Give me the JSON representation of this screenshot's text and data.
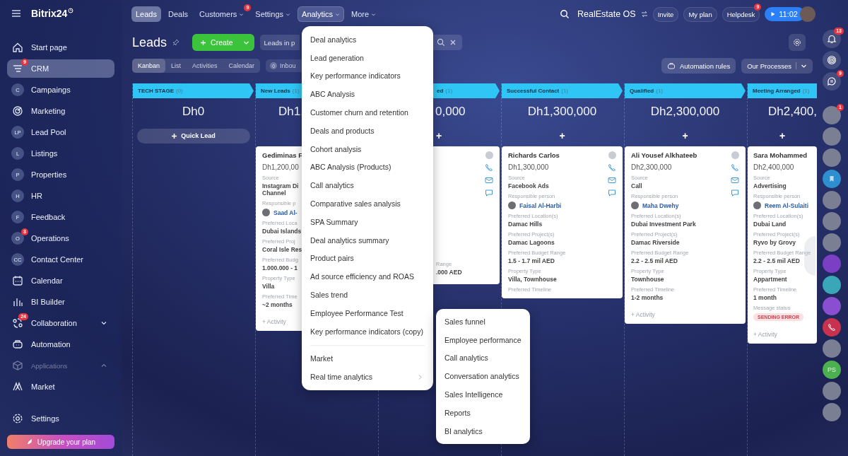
{
  "sidebar": {
    "brand": "Bitrix24",
    "items": [
      {
        "label": "Start page",
        "kind": "home",
        "selected": false
      },
      {
        "label": "CRM",
        "kind": "crm",
        "badge": "9",
        "selected": true
      },
      {
        "label": "Campaings",
        "kind": "letter",
        "letter": "C",
        "selected": false
      },
      {
        "label": "Marketing",
        "kind": "target",
        "selected": false
      },
      {
        "label": "Lead Pool",
        "kind": "letter",
        "letter": "LP",
        "selected": false
      },
      {
        "label": "Listings",
        "kind": "letter",
        "letter": "L",
        "selected": false
      },
      {
        "label": "Properties",
        "kind": "letter",
        "letter": "P",
        "selected": false
      },
      {
        "label": "HR",
        "kind": "letter",
        "letter": "H",
        "selected": false
      },
      {
        "label": "Feedback",
        "kind": "letter",
        "letter": "F",
        "selected": false
      },
      {
        "label": "Operations",
        "kind": "letter",
        "letter": "O",
        "badge": "3",
        "selected": false
      },
      {
        "label": "Contact Center",
        "kind": "letter",
        "letter": "CC",
        "selected": false
      },
      {
        "label": "Calendar",
        "kind": "calendar",
        "selected": false
      },
      {
        "label": "BI Builder",
        "kind": "chart",
        "selected": false
      },
      {
        "label": "Collaboration",
        "kind": "collab",
        "badge": "24",
        "selected": false,
        "expanded": false
      },
      {
        "label": "Automation",
        "kind": "robot",
        "selected": false
      },
      {
        "label": "Applications",
        "kind": "section",
        "selected": false,
        "expanded": true
      },
      {
        "label": "Market",
        "kind": "market",
        "selected": false
      }
    ],
    "settings": "Settings",
    "upgrade": "Upgrade your plan"
  },
  "topbar": {
    "nav": [
      {
        "label": "Leads",
        "selected": true,
        "open": false,
        "caret": false
      },
      {
        "label": "Deals",
        "selected": false,
        "open": false,
        "caret": false
      },
      {
        "label": "Customers",
        "selected": false,
        "open": false,
        "caret": true,
        "badge": "9"
      },
      {
        "label": "Settings",
        "selected": false,
        "open": false,
        "caret": true
      },
      {
        "label": "Analytics",
        "selected": false,
        "open": true,
        "caret": true
      },
      {
        "label": "More",
        "selected": false,
        "open": false,
        "caret": true
      }
    ],
    "workspace": "RealEstate OS",
    "buttons": [
      {
        "label": "Invite"
      },
      {
        "label": "My plan"
      },
      {
        "label": "Helpdesk",
        "badge": "9"
      }
    ],
    "timer": "11:02"
  },
  "header": {
    "title": "Leads",
    "create": "Create",
    "filter": "Leads in p"
  },
  "views": [
    {
      "label": "Kanban",
      "selected": true
    },
    {
      "label": "List",
      "selected": false
    },
    {
      "label": "Activities",
      "selected": false
    },
    {
      "label": "Calendar",
      "selected": false
    }
  ],
  "inbound": {
    "count": "0",
    "label": "Inbou"
  },
  "automation": "Automation rules",
  "processes": "Our Processes",
  "columns": [
    {
      "title": "TECH STAGE",
      "count": "(0)",
      "total": "Dh0",
      "add": {
        "kind": "quick",
        "label": "Quick Lead"
      }
    },
    {
      "title": "New Leads",
      "count": "(1)",
      "total": "Dh1,",
      "cards": [
        {
          "name": "Gediminas F",
          "amount": "Dh1,200,00",
          "fields": [
            {
              "kind": "text",
              "label": "Source",
              "value": "Instagram Di\nChannel"
            },
            {
              "kind": "person",
              "label": "Responsible p",
              "value": "Saad Al-"
            },
            {
              "kind": "text",
              "label": "Preferred Loca",
              "value": "Dubai Islands"
            },
            {
              "kind": "text",
              "label": "Preferred Proj",
              "value": "Coral Isle Res"
            },
            {
              "kind": "text",
              "label": "Preferred Budg",
              "value": "1.000.000 - 1"
            },
            {
              "kind": "text",
              "label": "Property Type",
              "value": "Villa"
            },
            {
              "kind": "text",
              "label": "Preferred Time",
              "value": "~2 months"
            }
          ],
          "activity": "+ Activity"
        }
      ]
    },
    {
      "title": "ed",
      "count": "(1)",
      "total": "0,000",
      "add": {
        "kind": "plus",
        "label": "+"
      },
      "cards": [
        {
          "fields": [
            {
              "kind": "text",
              "label": "Range",
              "value": ".000 AED"
            }
          ]
        }
      ]
    },
    {
      "title": "Successful Contact",
      "count": "(1)",
      "total": "Dh1,300,000",
      "add": {
        "kind": "plus",
        "label": "+"
      },
      "cards": [
        {
          "name": "Richards Carlos",
          "amount": "Dh1,300,000",
          "fields": [
            {
              "kind": "text",
              "label": "Source",
              "value": "Facebook Ads"
            },
            {
              "kind": "person",
              "label": "Responsible person",
              "value": "Faisal Al-Harbi"
            },
            {
              "kind": "text",
              "label": "Preferred Location(s)",
              "value": "Damac Hills"
            },
            {
              "kind": "text",
              "label": "Preferred Project(s)",
              "value": "Damac Lagoons"
            },
            {
              "kind": "text",
              "label": "Preferred Budget Range",
              "value": "1.5 - 1.7 mil AED"
            },
            {
              "kind": "text",
              "label": "Property Type",
              "value": "Villa, Townhouse"
            },
            {
              "kind": "text",
              "label": "Preferred Timeline"
            }
          ]
        }
      ]
    },
    {
      "title": "Qualified",
      "count": "(1)",
      "total": "Dh2,300,000",
      "add": {
        "kind": "plus",
        "label": "+"
      },
      "cards": [
        {
          "name": "Ali Yousef Alkhateeb",
          "amount": "Dh2,300,000",
          "fields": [
            {
              "kind": "text",
              "label": "Source",
              "value": "Call"
            },
            {
              "kind": "person",
              "label": "Responsible person",
              "value": "Maha Dwehy"
            },
            {
              "kind": "text",
              "label": "Preferred Location(s)",
              "value": "Dubai Investment Park"
            },
            {
              "kind": "text",
              "label": "Preferred Project(s)",
              "value": "Damac Riverside"
            },
            {
              "kind": "text",
              "label": "Preferred Budget Range",
              "value": "2.2 - 2.5 mil AED"
            },
            {
              "kind": "text",
              "label": "Property Type",
              "value": "Townhouse"
            },
            {
              "kind": "text",
              "label": "Preferred Timeline",
              "value": "1-2 months"
            }
          ],
          "activity": "+ Activity"
        }
      ]
    },
    {
      "title": "Meeting Arranged",
      "count": "(1)",
      "total": "Dh2,400,",
      "add": {
        "kind": "plus",
        "label": "+"
      },
      "cards": [
        {
          "name": "Sara Mohammed",
          "amount": "Dh2,400,000",
          "fields": [
            {
              "kind": "text",
              "label": "Source",
              "value": "Advertising"
            },
            {
              "kind": "person",
              "label": "Responsible person",
              "value": "Reem Al-Sulaiti"
            },
            {
              "kind": "text",
              "label": "Preferred Location(s)",
              "value": "Dubai Land"
            },
            {
              "kind": "text",
              "label": "Preferred Project(s)",
              "value": "Ryvo by Grovy"
            },
            {
              "kind": "text",
              "label": "Preferred Budget Range",
              "value": "2.2 - 2.5 mil AED"
            },
            {
              "kind": "text",
              "label": "Property Type",
              "value": "Appartment"
            },
            {
              "kind": "text",
              "label": "Preferred Timeline",
              "value": "1 month"
            },
            {
              "kind": "status",
              "label": "Message status",
              "value": "SENDING ERROR"
            }
          ],
          "activity": "+ Activity"
        }
      ]
    }
  ],
  "menu": {
    "groups": [
      [
        {
          "label": "Deal analytics",
          "kind": "item"
        },
        {
          "label": "Lead generation",
          "kind": "item"
        },
        {
          "label": "Key performance indicators",
          "kind": "item"
        },
        {
          "label": "ABC Analysis",
          "kind": "item"
        },
        {
          "label": "Customer churn and retention",
          "kind": "item"
        },
        {
          "label": "Deals and products",
          "kind": "item"
        },
        {
          "label": "Cohort analysis",
          "kind": "item"
        },
        {
          "label": "ABC Analysis (Products)",
          "kind": "item"
        },
        {
          "label": "Call analytics",
          "kind": "item"
        },
        {
          "label": "Comparative sales analysis",
          "kind": "item"
        },
        {
          "label": "SPA Summary",
          "kind": "item"
        },
        {
          "label": "Deal analytics summary",
          "kind": "item"
        },
        {
          "label": "Product pairs",
          "kind": "item"
        },
        {
          "label": "Ad source efficiency and ROAS",
          "kind": "item"
        },
        {
          "label": "Sales trend",
          "kind": "item"
        },
        {
          "label": "Employee Performance Test",
          "kind": "item"
        },
        {
          "label": "Key performance indicators (copy)",
          "kind": "item"
        }
      ],
      [
        {
          "label": "Market",
          "kind": "item"
        },
        {
          "label": "Real time analytics",
          "kind": "submenu"
        }
      ]
    ]
  },
  "submenu": [
    "Sales funnel",
    "Employee performance",
    "Call analytics",
    "Conversation analytics",
    "Sales Intelligence",
    "Reports",
    "BI analytics"
  ],
  "rail": [
    {
      "kind": "bell",
      "badge": "13"
    },
    {
      "kind": "spiral"
    },
    {
      "kind": "chat",
      "badge": "9"
    },
    {
      "kind": "avatar",
      "badge": "1"
    },
    {
      "kind": "avatar"
    },
    {
      "kind": "avatar"
    },
    {
      "kind": "bookmark",
      "color": "#2d8fd0"
    },
    {
      "kind": "avatar"
    },
    {
      "kind": "avatar"
    },
    {
      "kind": "avatar"
    },
    {
      "kind": "dot",
      "color": "#7b3fc4"
    },
    {
      "kind": "dot",
      "color": "#3aa7b8"
    },
    {
      "kind": "dot",
      "color": "#8a4fd0"
    },
    {
      "kind": "phone",
      "color": "#c8324f"
    },
    {
      "kind": "avatar"
    },
    {
      "kind": "initials",
      "text": "PS",
      "color": "#4caf50"
    },
    {
      "kind": "avatar"
    },
    {
      "kind": "avatar"
    }
  ]
}
